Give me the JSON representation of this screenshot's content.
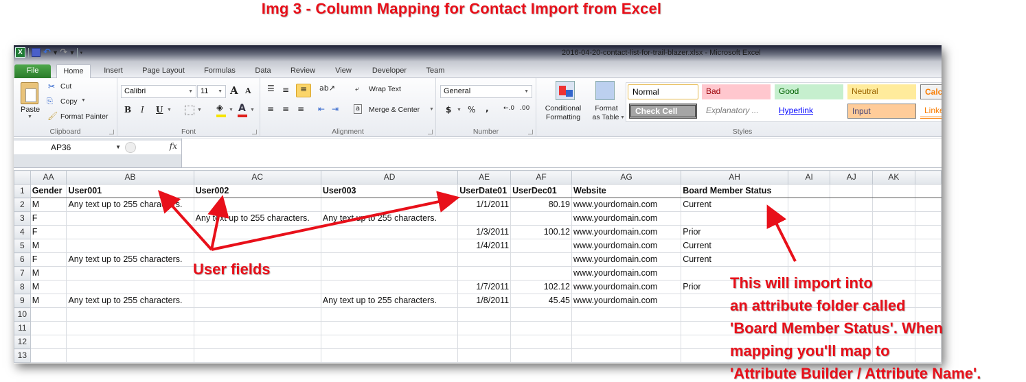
{
  "caption": "Img 3 - Column Mapping for Contact Import from Excel",
  "window": {
    "title": "2016-04-20-contact-list-for-trail-blazer.xlsx  -  Microsoft Excel",
    "qat_icons": [
      "excel-logo-icon",
      "save-icon",
      "undo-icon",
      "redo-icon",
      "customize-qat-icon"
    ]
  },
  "tabs": [
    {
      "label": "File"
    },
    {
      "label": "Home",
      "active": true
    },
    {
      "label": "Insert"
    },
    {
      "label": "Page Layout"
    },
    {
      "label": "Formulas"
    },
    {
      "label": "Data"
    },
    {
      "label": "Review"
    },
    {
      "label": "View"
    },
    {
      "label": "Developer"
    },
    {
      "label": "Team"
    }
  ],
  "ribbon": {
    "clipboard": {
      "label": "Clipboard",
      "paste": "Paste",
      "cut": "Cut",
      "copy": "Copy",
      "format_painter": "Format Painter"
    },
    "font": {
      "label": "Font",
      "font_name": "Calibri",
      "font_size": "11",
      "bold": "B",
      "italic": "I",
      "underline": "U",
      "fill_color": "#f6e400",
      "font_color": "#e0201c"
    },
    "alignment": {
      "label": "Alignment",
      "wrap_text": "Wrap Text",
      "merge_center": "Merge & Center"
    },
    "number": {
      "label": "Number",
      "format": "General",
      "currency": "$",
      "percent": "%",
      "comma": ","
    },
    "styles": {
      "label": "Styles",
      "conditional_formatting_1": "Conditional",
      "conditional_formatting_2": "Formatting",
      "format_as_table_1": "Format",
      "format_as_table_2": "as Table",
      "cells": [
        {
          "label": "Normal",
          "bg": "#ffffff",
          "fg": "#000000"
        },
        {
          "label": "Bad",
          "bg": "#ffc7ce",
          "fg": "#9c0006"
        },
        {
          "label": "Good",
          "bg": "#c6efce",
          "fg": "#006100"
        },
        {
          "label": "Neutral",
          "bg": "#ffeb9c",
          "fg": "#9c6500"
        },
        {
          "label": "Calcu",
          "bg": "#f2f2f2",
          "fg": "#fa7d00"
        },
        {
          "label": "Check Cell",
          "bg": "#a5a5a5",
          "fg": "#ffffff"
        },
        {
          "label": "Explanatory ...",
          "bg": "#ffffff",
          "fg": "#7f7f7f"
        },
        {
          "label": "Hyperlink",
          "bg": "#ffffff",
          "fg": "#0000ff"
        },
        {
          "label": "Input",
          "bg": "#ffcc99",
          "fg": "#3f3f76"
        },
        {
          "label": "Linke",
          "bg": "#ffffff",
          "fg": "#fa7d00"
        }
      ]
    }
  },
  "formula_bar": {
    "name_box": "AP36",
    "fx": "fx",
    "value": ""
  },
  "sheet": {
    "columns": [
      "AA",
      "AB",
      "AC",
      "AD",
      "AE",
      "AF",
      "AG",
      "AH",
      "AI",
      "AJ",
      "AK",
      ""
    ],
    "rows": [
      {
        "n": "1",
        "cells": [
          "Gender",
          "User001",
          "User002",
          "User003",
          "UserDate01",
          "UserDec01",
          "Website",
          "Board Member Status",
          "",
          "",
          "",
          ""
        ]
      },
      {
        "n": "2",
        "cells": [
          "M",
          "Any text up to 255 characters.",
          "",
          "",
          "1/1/2011",
          "80.19",
          "www.yourdomain.com",
          "Current",
          "",
          "",
          "",
          ""
        ]
      },
      {
        "n": "3",
        "cells": [
          "F",
          "",
          "Any text up to 255 characters.",
          "Any text up to 255 characters.",
          "",
          "",
          "www.yourdomain.com",
          "",
          "",
          "",
          "",
          ""
        ]
      },
      {
        "n": "4",
        "cells": [
          "F",
          "",
          "",
          "",
          "1/3/2011",
          "100.12",
          "www.yourdomain.com",
          "Prior",
          "",
          "",
          "",
          ""
        ]
      },
      {
        "n": "5",
        "cells": [
          "M",
          "",
          "",
          "",
          "1/4/2011",
          "",
          "www.yourdomain.com",
          "Current",
          "",
          "",
          "",
          ""
        ]
      },
      {
        "n": "6",
        "cells": [
          "F",
          "Any text up to 255 characters.",
          "",
          "",
          "",
          "",
          "www.yourdomain.com",
          "Current",
          "",
          "",
          "",
          ""
        ]
      },
      {
        "n": "7",
        "cells": [
          "M",
          "",
          "",
          "",
          "",
          "",
          "www.yourdomain.com",
          "",
          "",
          "",
          "",
          ""
        ]
      },
      {
        "n": "8",
        "cells": [
          "M",
          "",
          "",
          "",
          "1/7/2011",
          "102.12",
          "www.yourdomain.com",
          "Prior",
          "",
          "",
          "",
          ""
        ]
      },
      {
        "n": "9",
        "cells": [
          "M",
          "Any text up to 255 characters.",
          "",
          "Any text up to 255 characters.",
          "1/8/2011",
          "45.45",
          "www.yourdomain.com",
          "",
          "",
          "",
          "",
          ""
        ]
      },
      {
        "n": "10",
        "cells": [
          "",
          "",
          "",
          "",
          "",
          "",
          "",
          "",
          "",
          "",
          "",
          ""
        ]
      },
      {
        "n": "11",
        "cells": [
          "",
          "",
          "",
          "",
          "",
          "",
          "",
          "",
          "",
          "",
          "",
          ""
        ]
      },
      {
        "n": "12",
        "cells": [
          "",
          "",
          "",
          "",
          "",
          "",
          "",
          "",
          "",
          "",
          "",
          ""
        ]
      },
      {
        "n": "13",
        "cells": [
          "",
          "",
          "",
          "",
          "",
          "",
          "",
          "",
          "",
          "",
          "",
          ""
        ]
      }
    ],
    "numeric_columns": [
      4,
      5
    ]
  },
  "annotations": {
    "user_fields": "User fields",
    "import_note": [
      "This will import into",
      "an attribute folder called",
      "'Board Member Status'.  When",
      "mapping you'll map to",
      "'Attribute Builder / Attribute Name'."
    ],
    "color": "#e8101a"
  }
}
